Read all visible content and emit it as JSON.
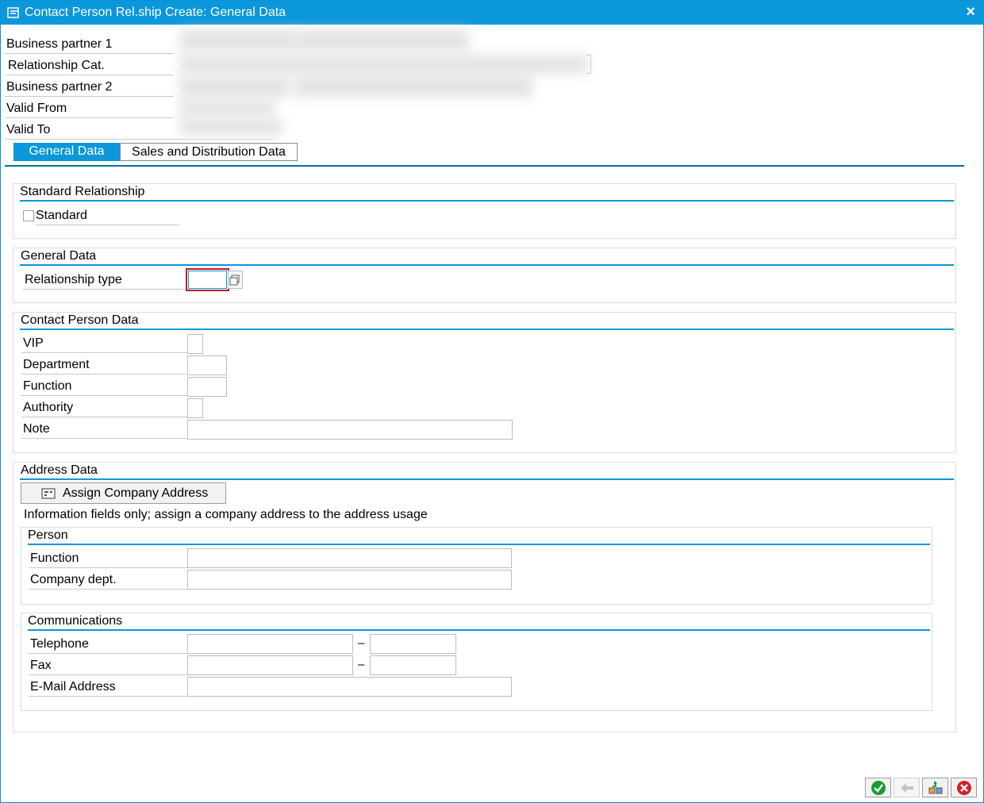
{
  "window": {
    "title": "Contact Person Rel.ship Create: General Data",
    "close_label": "×"
  },
  "header": {
    "bp1_label": "Business partner 1",
    "relcat_label": "Relationship Cat.",
    "bp2_label": "Business partner 2",
    "valid_from_label": "Valid From",
    "valid_to_label": "Valid To"
  },
  "tabs": [
    {
      "label": "General Data",
      "active": true
    },
    {
      "label": "Sales and Distribution Data",
      "active": false
    }
  ],
  "standard_relationship": {
    "title": "Standard Relationship",
    "standard_label": "Standard"
  },
  "general_data": {
    "title": "General Data",
    "relationship_type_label": "Relationship type",
    "relationship_type_value": ""
  },
  "contact_person_data": {
    "title": "Contact Person Data",
    "vip_label": "VIP",
    "department_label": "Department",
    "function_label": "Function",
    "authority_label": "Authority",
    "note_label": "Note"
  },
  "address_data": {
    "title": "Address Data",
    "assign_button_label": "Assign Company Address",
    "info_text": "Information fields only; assign a company address to the address usage",
    "person": {
      "title": "Person",
      "function_label": "Function",
      "company_dept_label": "Company dept."
    },
    "communications": {
      "title": "Communications",
      "telephone_label": "Telephone",
      "fax_label": "Fax",
      "email_label": "E-Mail Address",
      "separator": "–"
    }
  },
  "colors": {
    "accent": "#0a97dc",
    "ok_green": "#1a9c2e",
    "cancel_red": "#d6202a"
  },
  "footer_icons": [
    "confirm-icon",
    "back-icon",
    "transfer-icon",
    "cancel-icon"
  ]
}
